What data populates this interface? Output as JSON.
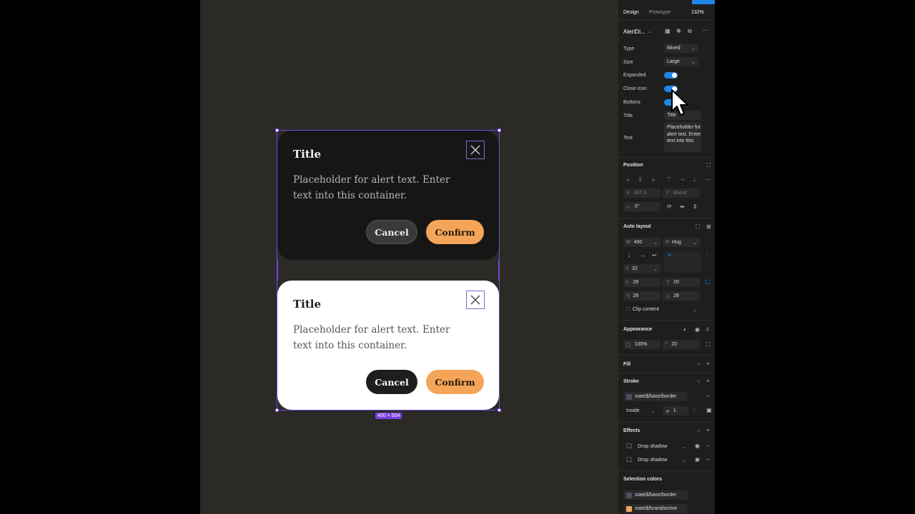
{
  "canvas": {
    "selection_size": "400 × 504",
    "dialogs": [
      {
        "title": "Title",
        "text": "Placeholder for alert text. Enter text into this container.",
        "cancel": "Cancel",
        "confirm": "Confirm"
      },
      {
        "title": "Title",
        "text": "Placeholder for alert text. Enter text into this container.",
        "cancel": "Cancel",
        "confirm": "Confirm"
      }
    ]
  },
  "panel": {
    "tabs": {
      "design": "Design",
      "prototype": "Prototype",
      "zoom": "132%"
    },
    "component_name": "AlertDi...",
    "props": {
      "type_label": "Type",
      "type_value": "Mixed",
      "size_label": "Size",
      "size_value": "Large",
      "expanded_label": "Expanded",
      "close_icon_label": "Close icon",
      "buttons_label": "Buttons",
      "title_label": "Title",
      "title_value": "Title",
      "text_label": "Text",
      "text_value": "Placeholder for alert text. Enter text into this"
    },
    "position": {
      "heading": "Position",
      "x_label": "X",
      "x_value": "387.5",
      "y_label": "Y",
      "y_value": "Mixed",
      "rotation": "0°"
    },
    "auto_layout": {
      "heading": "Auto layout",
      "w_label": "W",
      "w_value": "400",
      "h_label": "H",
      "h_value": "Hug",
      "gap": "32",
      "pad_left": "28",
      "pad_top": "20",
      "pad_right": "28",
      "pad_bottom": "28",
      "clip": "Clip content"
    },
    "appearance": {
      "heading": "Appearance",
      "opacity": "100%",
      "radius": "20"
    },
    "fill": {
      "heading": "Fill"
    },
    "stroke": {
      "heading": "Stroke",
      "name": "state$/base/border",
      "position": "Inside",
      "weight": "1"
    },
    "effects": {
      "heading": "Effects",
      "items": [
        "Drop shadow",
        "Drop shadow"
      ]
    },
    "selection_colors": {
      "heading": "Selection colors",
      "items": [
        {
          "name": "state$/base/border",
          "color": "#4a4f63"
        },
        {
          "name": "state$/brand/active",
          "color": "#f4a559"
        }
      ]
    }
  }
}
